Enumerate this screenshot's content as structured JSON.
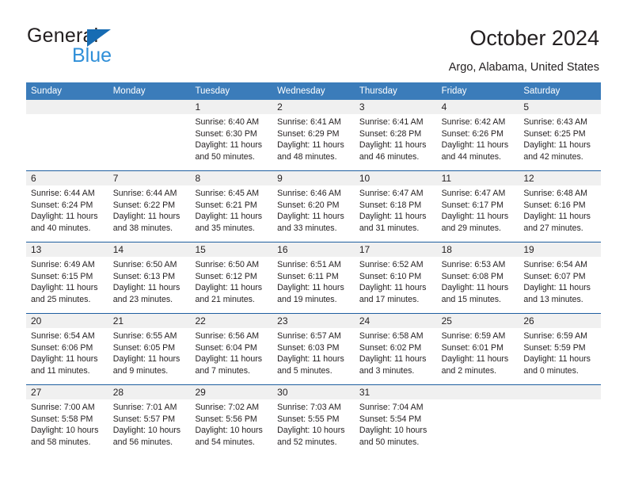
{
  "brand": {
    "name_top": "General",
    "name_bottom": "Blue",
    "accent_blue": "#176cb3",
    "light_blue": "#2f8fd8"
  },
  "header": {
    "title": "October 2024",
    "subtitle": "Argo, Alabama, United States"
  },
  "calendar": {
    "header_bg": "#3b7cba",
    "row_rule": "#1f5fa0",
    "daynum_bg": "#f0f0f0",
    "weekday_names": [
      "Sunday",
      "Monday",
      "Tuesday",
      "Wednesday",
      "Thursday",
      "Friday",
      "Saturday"
    ],
    "weeks": [
      [
        {
          "day": ""
        },
        {
          "day": ""
        },
        {
          "day": "1",
          "sunrise": "Sunrise: 6:40 AM",
          "sunset": "Sunset: 6:30 PM",
          "daylight_line1": "Daylight: 11 hours",
          "daylight_line2": "and 50 minutes."
        },
        {
          "day": "2",
          "sunrise": "Sunrise: 6:41 AM",
          "sunset": "Sunset: 6:29 PM",
          "daylight_line1": "Daylight: 11 hours",
          "daylight_line2": "and 48 minutes."
        },
        {
          "day": "3",
          "sunrise": "Sunrise: 6:41 AM",
          "sunset": "Sunset: 6:28 PM",
          "daylight_line1": "Daylight: 11 hours",
          "daylight_line2": "and 46 minutes."
        },
        {
          "day": "4",
          "sunrise": "Sunrise: 6:42 AM",
          "sunset": "Sunset: 6:26 PM",
          "daylight_line1": "Daylight: 11 hours",
          "daylight_line2": "and 44 minutes."
        },
        {
          "day": "5",
          "sunrise": "Sunrise: 6:43 AM",
          "sunset": "Sunset: 6:25 PM",
          "daylight_line1": "Daylight: 11 hours",
          "daylight_line2": "and 42 minutes."
        }
      ],
      [
        {
          "day": "6",
          "sunrise": "Sunrise: 6:44 AM",
          "sunset": "Sunset: 6:24 PM",
          "daylight_line1": "Daylight: 11 hours",
          "daylight_line2": "and 40 minutes."
        },
        {
          "day": "7",
          "sunrise": "Sunrise: 6:44 AM",
          "sunset": "Sunset: 6:22 PM",
          "daylight_line1": "Daylight: 11 hours",
          "daylight_line2": "and 38 minutes."
        },
        {
          "day": "8",
          "sunrise": "Sunrise: 6:45 AM",
          "sunset": "Sunset: 6:21 PM",
          "daylight_line1": "Daylight: 11 hours",
          "daylight_line2": "and 35 minutes."
        },
        {
          "day": "9",
          "sunrise": "Sunrise: 6:46 AM",
          "sunset": "Sunset: 6:20 PM",
          "daylight_line1": "Daylight: 11 hours",
          "daylight_line2": "and 33 minutes."
        },
        {
          "day": "10",
          "sunrise": "Sunrise: 6:47 AM",
          "sunset": "Sunset: 6:18 PM",
          "daylight_line1": "Daylight: 11 hours",
          "daylight_line2": "and 31 minutes."
        },
        {
          "day": "11",
          "sunrise": "Sunrise: 6:47 AM",
          "sunset": "Sunset: 6:17 PM",
          "daylight_line1": "Daylight: 11 hours",
          "daylight_line2": "and 29 minutes."
        },
        {
          "day": "12",
          "sunrise": "Sunrise: 6:48 AM",
          "sunset": "Sunset: 6:16 PM",
          "daylight_line1": "Daylight: 11 hours",
          "daylight_line2": "and 27 minutes."
        }
      ],
      [
        {
          "day": "13",
          "sunrise": "Sunrise: 6:49 AM",
          "sunset": "Sunset: 6:15 PM",
          "daylight_line1": "Daylight: 11 hours",
          "daylight_line2": "and 25 minutes."
        },
        {
          "day": "14",
          "sunrise": "Sunrise: 6:50 AM",
          "sunset": "Sunset: 6:13 PM",
          "daylight_line1": "Daylight: 11 hours",
          "daylight_line2": "and 23 minutes."
        },
        {
          "day": "15",
          "sunrise": "Sunrise: 6:50 AM",
          "sunset": "Sunset: 6:12 PM",
          "daylight_line1": "Daylight: 11 hours",
          "daylight_line2": "and 21 minutes."
        },
        {
          "day": "16",
          "sunrise": "Sunrise: 6:51 AM",
          "sunset": "Sunset: 6:11 PM",
          "daylight_line1": "Daylight: 11 hours",
          "daylight_line2": "and 19 minutes."
        },
        {
          "day": "17",
          "sunrise": "Sunrise: 6:52 AM",
          "sunset": "Sunset: 6:10 PM",
          "daylight_line1": "Daylight: 11 hours",
          "daylight_line2": "and 17 minutes."
        },
        {
          "day": "18",
          "sunrise": "Sunrise: 6:53 AM",
          "sunset": "Sunset: 6:08 PM",
          "daylight_line1": "Daylight: 11 hours",
          "daylight_line2": "and 15 minutes."
        },
        {
          "day": "19",
          "sunrise": "Sunrise: 6:54 AM",
          "sunset": "Sunset: 6:07 PM",
          "daylight_line1": "Daylight: 11 hours",
          "daylight_line2": "and 13 minutes."
        }
      ],
      [
        {
          "day": "20",
          "sunrise": "Sunrise: 6:54 AM",
          "sunset": "Sunset: 6:06 PM",
          "daylight_line1": "Daylight: 11 hours",
          "daylight_line2": "and 11 minutes."
        },
        {
          "day": "21",
          "sunrise": "Sunrise: 6:55 AM",
          "sunset": "Sunset: 6:05 PM",
          "daylight_line1": "Daylight: 11 hours",
          "daylight_line2": "and 9 minutes."
        },
        {
          "day": "22",
          "sunrise": "Sunrise: 6:56 AM",
          "sunset": "Sunset: 6:04 PM",
          "daylight_line1": "Daylight: 11 hours",
          "daylight_line2": "and 7 minutes."
        },
        {
          "day": "23",
          "sunrise": "Sunrise: 6:57 AM",
          "sunset": "Sunset: 6:03 PM",
          "daylight_line1": "Daylight: 11 hours",
          "daylight_line2": "and 5 minutes."
        },
        {
          "day": "24",
          "sunrise": "Sunrise: 6:58 AM",
          "sunset": "Sunset: 6:02 PM",
          "daylight_line1": "Daylight: 11 hours",
          "daylight_line2": "and 3 minutes."
        },
        {
          "day": "25",
          "sunrise": "Sunrise: 6:59 AM",
          "sunset": "Sunset: 6:01 PM",
          "daylight_line1": "Daylight: 11 hours",
          "daylight_line2": "and 2 minutes."
        },
        {
          "day": "26",
          "sunrise": "Sunrise: 6:59 AM",
          "sunset": "Sunset: 5:59 PM",
          "daylight_line1": "Daylight: 11 hours",
          "daylight_line2": "and 0 minutes."
        }
      ],
      [
        {
          "day": "27",
          "sunrise": "Sunrise: 7:00 AM",
          "sunset": "Sunset: 5:58 PM",
          "daylight_line1": "Daylight: 10 hours",
          "daylight_line2": "and 58 minutes."
        },
        {
          "day": "28",
          "sunrise": "Sunrise: 7:01 AM",
          "sunset": "Sunset: 5:57 PM",
          "daylight_line1": "Daylight: 10 hours",
          "daylight_line2": "and 56 minutes."
        },
        {
          "day": "29",
          "sunrise": "Sunrise: 7:02 AM",
          "sunset": "Sunset: 5:56 PM",
          "daylight_line1": "Daylight: 10 hours",
          "daylight_line2": "and 54 minutes."
        },
        {
          "day": "30",
          "sunrise": "Sunrise: 7:03 AM",
          "sunset": "Sunset: 5:55 PM",
          "daylight_line1": "Daylight: 10 hours",
          "daylight_line2": "and 52 minutes."
        },
        {
          "day": "31",
          "sunrise": "Sunrise: 7:04 AM",
          "sunset": "Sunset: 5:54 PM",
          "daylight_line1": "Daylight: 10 hours",
          "daylight_line2": "and 50 minutes."
        },
        {
          "day": ""
        },
        {
          "day": ""
        }
      ]
    ]
  }
}
